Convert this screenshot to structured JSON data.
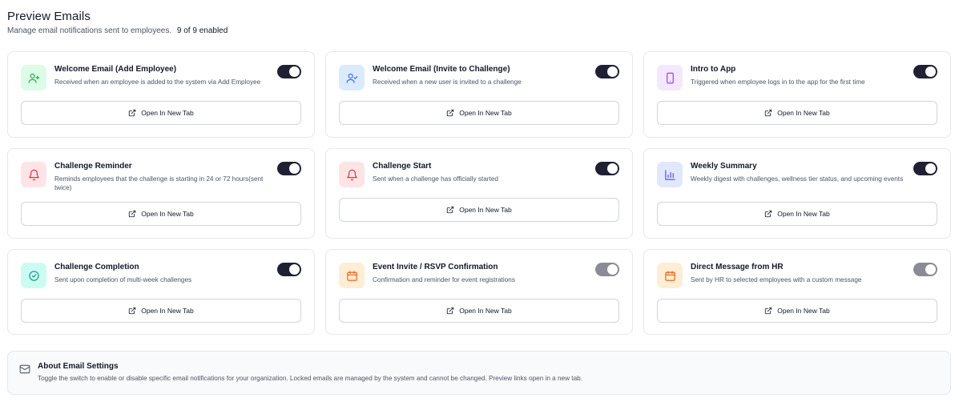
{
  "header": {
    "title": "Preview Emails",
    "subtitle": "Manage email notifications sent to employees.",
    "enabled_count": "9 of 9 enabled"
  },
  "colors": {
    "toggle_on": "#1f2033",
    "toggle_locked": "#8b8b95"
  },
  "open_label": "Open In New Tab",
  "cards": [
    {
      "title": "Welcome Email (Add Employee)",
      "desc": "Received when an employee is added to the system via Add Employee",
      "icon": "user-plus-icon",
      "enabled": true,
      "locked": false
    },
    {
      "title": "Welcome Email (Invite to Challenge)",
      "desc": "Received when a new user is invited to a challenge",
      "icon": "user-check-icon",
      "enabled": true,
      "locked": false
    },
    {
      "title": "Intro to App",
      "desc": "Triggered when employee logs in to the app for the first time",
      "icon": "smartphone-icon",
      "enabled": true,
      "locked": false
    },
    {
      "title": "Challenge Reminder",
      "desc": "Reminds employees that the challenge is starting in 24 or 72 hours(sent twice)",
      "icon": "bell-icon",
      "enabled": true,
      "locked": false
    },
    {
      "title": "Challenge Start",
      "desc": "Sent when a challenge has officially started",
      "icon": "bell-icon",
      "enabled": true,
      "locked": false
    },
    {
      "title": "Weekly Summary",
      "desc": "Weekly digest with challenges, wellness tier status, and upcoming events",
      "icon": "bar-chart-icon",
      "enabled": true,
      "locked": false
    },
    {
      "title": "Challenge Completion",
      "desc": "Sent upon completion of multi-week challenges",
      "icon": "check-circle-icon",
      "enabled": true,
      "locked": false
    },
    {
      "title": "Event Invite / RSVP Confirmation",
      "desc": "Confirmation and reminder for event registrations",
      "icon": "calendar-icon",
      "enabled": true,
      "locked": true
    },
    {
      "title": "Direct Message from HR",
      "desc": "Sent by HR to selected employees with a custom message",
      "icon": "calendar-icon",
      "enabled": true,
      "locked": true
    }
  ],
  "about": {
    "title": "About Email Settings",
    "text": "Toggle the switch to enable or disable specific email notifications for your organization. Locked emails are managed by the system and cannot be changed. Preview links open in a new tab."
  }
}
